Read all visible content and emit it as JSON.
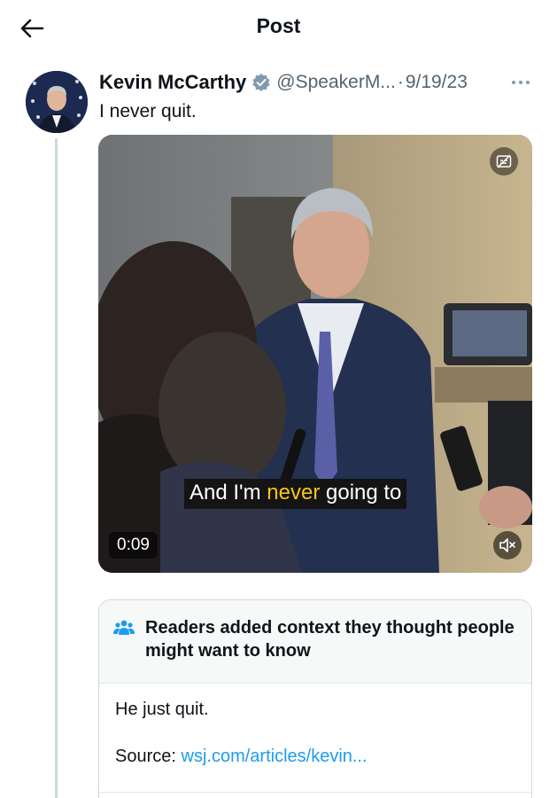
{
  "header": {
    "title": "Post",
    "back_icon": "arrow-left-icon"
  },
  "tweet": {
    "author_name": "Kevin McCarthy",
    "handle": "@SpeakerM...",
    "separator": "·",
    "date": "9/19/23",
    "text": "I never quit.",
    "verified_color": "#829aab"
  },
  "video": {
    "subtitle_before": "And I'm ",
    "subtitle_highlight": "never",
    "subtitle_after": " going to",
    "timestamp": "0:09",
    "caption_icon": "captions-icon",
    "mute_icon": "speaker-muted-icon"
  },
  "community_note": {
    "title": "Readers added context they thought people might want to know",
    "body": "He just quit.",
    "source_label": "Source:",
    "source_link": "wsj.com/articles/kevin...",
    "icon": "people-icon",
    "accent_color": "#1d9bf0"
  }
}
